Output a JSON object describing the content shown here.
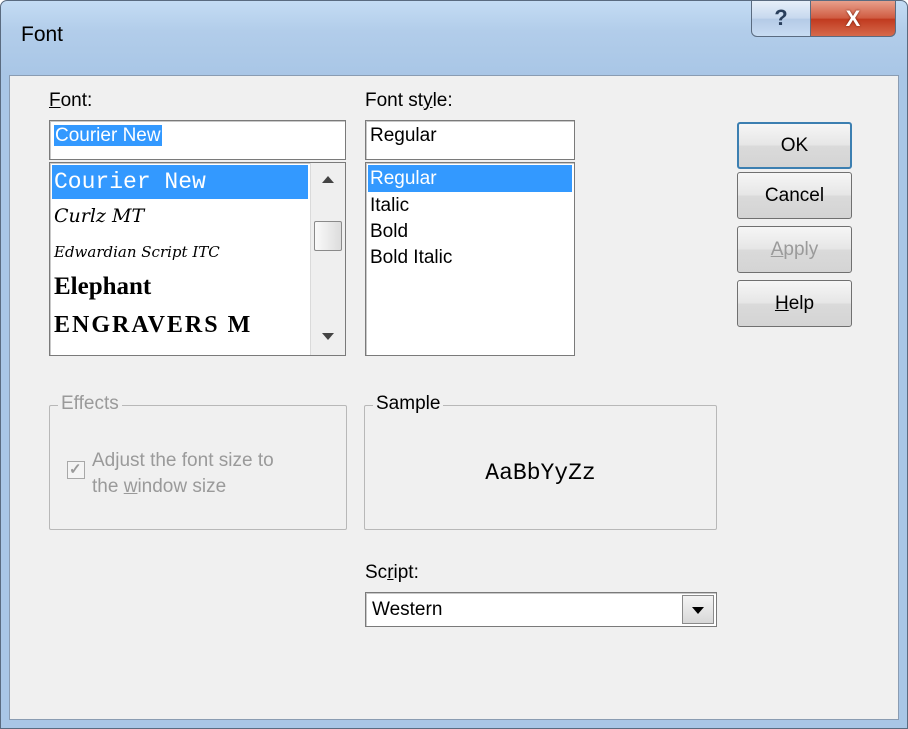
{
  "window": {
    "title": "Font",
    "help_label": "?",
    "close_label": "X"
  },
  "font_panel": {
    "label": "Font:",
    "value": "Courier New",
    "items": [
      "Courier New",
      "Curlz MT",
      "Edwardian Script ITC",
      "Elephant",
      "ENGRAVERS M"
    ],
    "selected_index": 0
  },
  "style_panel": {
    "label": "Font style:",
    "value": "Regular",
    "items": [
      "Regular",
      "Italic",
      "Bold",
      "Bold Italic"
    ],
    "selected_index": 0
  },
  "buttons": {
    "ok": "OK",
    "cancel": "Cancel",
    "apply": "Apply",
    "help": "Help"
  },
  "effects": {
    "legend": "Effects",
    "checkbox_checked": true,
    "checkbox_line1": "Adjust the font size to",
    "checkbox_line2": "the window size"
  },
  "sample": {
    "legend": "Sample",
    "text": "AaBbYyZz"
  },
  "script": {
    "label": "Script:",
    "value": "Western"
  },
  "colors": {
    "selection": "#3399ff",
    "dialog_face": "#f0f0f0",
    "close_button": "#c0391e",
    "disabled_text": "#9a9a9a"
  }
}
